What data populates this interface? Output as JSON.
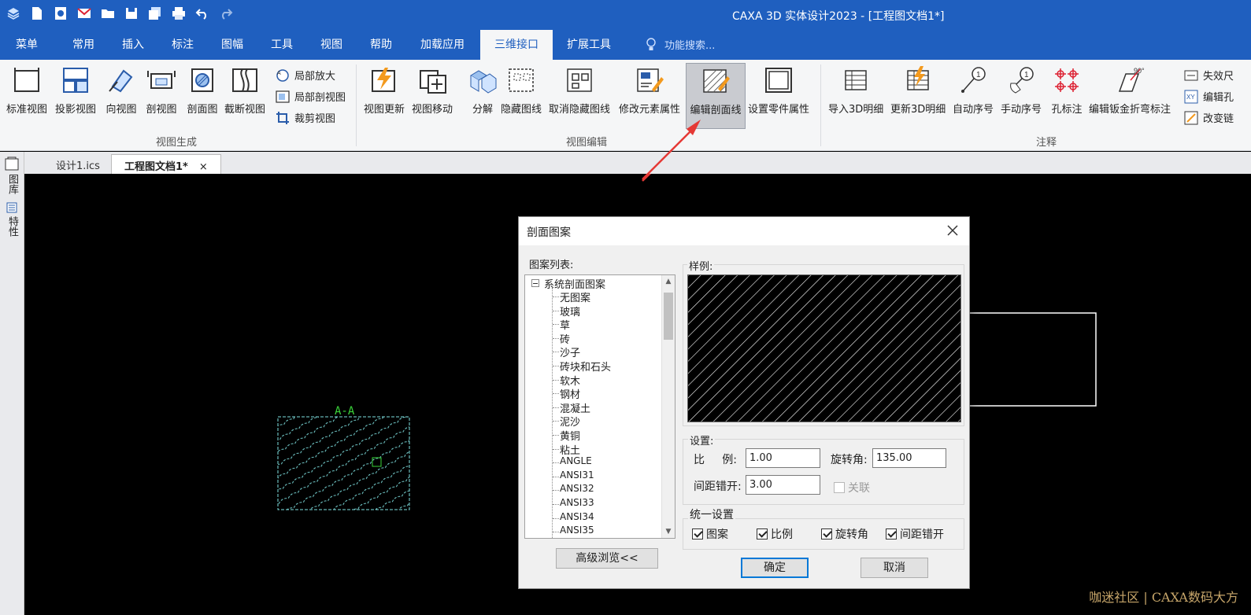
{
  "app": {
    "title": "CAXA 3D 实体设计2023 - [工程图文档1*]"
  },
  "quick_access": [
    "layers-icon",
    "new-icon",
    "open-template-icon",
    "mail-icon",
    "folder-icon",
    "save-icon",
    "save-all-icon",
    "print-icon",
    "undo-icon",
    "redo-icon"
  ],
  "menu": {
    "tabs": [
      "菜单",
      "常用",
      "插入",
      "标注",
      "图幅",
      "工具",
      "视图",
      "帮助",
      "加载应用",
      "三维接口",
      "扩展工具"
    ],
    "active": "三维接口",
    "search_placeholder": "功能搜索..."
  },
  "ribbon": {
    "groups": [
      "视图生成",
      "视图编辑",
      "注释"
    ],
    "view_gen": [
      "标准视图",
      "投影视图",
      "向视图",
      "剖视图",
      "剖面图",
      "截断视图"
    ],
    "view_gen_small": [
      "局部放大",
      "局部剖视图",
      "裁剪视图"
    ],
    "view_edit": [
      "视图更新",
      "视图移动",
      "分解",
      "隐藏图线",
      "取消隐藏图线",
      "修改元素属性",
      "编辑剖面线",
      "设置零件属性"
    ],
    "annot": [
      "导入3D明细",
      "更新3D明细",
      "自动序号",
      "手动序号",
      "孔标注",
      "编辑钣金折弯标注"
    ],
    "annot_small": [
      "失效尺",
      "编辑孔",
      "改变链"
    ],
    "annot_icon_text": [
      "90°"
    ]
  },
  "doc_tabs": {
    "items": [
      "设计1.ics",
      "工程图文档1*"
    ],
    "active": "工程图文档1*",
    "close": "×"
  },
  "sidebar": {
    "items": [
      "图库",
      "特性"
    ]
  },
  "canvas": {
    "section_label": "A-A"
  },
  "dialog": {
    "title": "剖面图案",
    "list_label": "图案列表:",
    "tree_root": "系统剖面图案",
    "patterns": [
      "无图案",
      "玻璃",
      "草",
      "砖",
      "沙子",
      "砖块和石头",
      "软木",
      "钢材",
      "混凝土",
      "泥沙",
      "黄铜",
      "粘土",
      "ANGLE",
      "ANSI31",
      "ANSI32",
      "ANSI33",
      "ANSI34",
      "ANSI35"
    ],
    "preview_label": "样例:",
    "settings_label": "设置:",
    "scale_label": "比     例:",
    "scale_value": "1.00",
    "rotation_label": "旋转角:",
    "rotation_value": "135.00",
    "spacing_label": "间距错开:",
    "spacing_value": "3.00",
    "assoc_label": "关联",
    "unify_label": "统一设置",
    "unify": [
      {
        "label": "图案",
        "checked": true
      },
      {
        "label": "比例",
        "checked": true
      },
      {
        "label": "旋转角",
        "checked": true
      },
      {
        "label": "间距错开",
        "checked": true
      }
    ],
    "browse_button": "高级浏览<<",
    "ok_button": "确定",
    "cancel_button": "取消"
  },
  "watermark": "咖迷社区 | CAXA数码大方",
  "colors": {
    "title_bar": "#1f5fbf",
    "ribbon": "#f5f6f7",
    "canvas": "#000000",
    "hatch_preview": "#ffffff",
    "hatch_part": "#7ee0e0",
    "label_green": "#3ad43a"
  }
}
